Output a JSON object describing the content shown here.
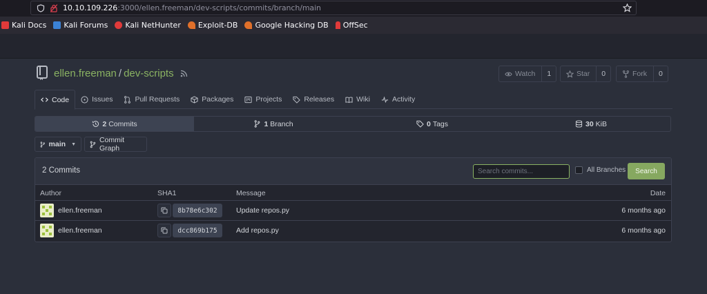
{
  "browser": {
    "url_host": "10.10.109.226",
    "url_rest": ":3000/ellen.freeman/dev-scripts/commits/branch/main",
    "bookmarks": [
      {
        "label": "Kali Docs",
        "color": "#e03a3a"
      },
      {
        "label": "Kali Forums",
        "color": "#3b82d6"
      },
      {
        "label": "Kali NetHunter",
        "color": "#e03a3a"
      },
      {
        "label": "Exploit-DB",
        "color": "#e0702a"
      },
      {
        "label": "Google Hacking DB",
        "color": "#e0702a"
      },
      {
        "label": "OffSec",
        "color": "#e03a3a"
      }
    ]
  },
  "repo": {
    "owner": "ellen.freeman",
    "separator": "/",
    "name": "dev-scripts",
    "watch_label": "Watch",
    "watch_count": "1",
    "star_label": "Star",
    "star_count": "0",
    "fork_label": "Fork",
    "fork_count": "0"
  },
  "tabs": [
    "Code",
    "Issues",
    "Pull Requests",
    "Packages",
    "Projects",
    "Releases",
    "Wiki",
    "Activity"
  ],
  "stats": {
    "commits_num": "2",
    "commits_label": "Commits",
    "branches_num": "1",
    "branches_label": "Branch",
    "tags_num": "0",
    "tags_label": "Tags",
    "size_num": "30",
    "size_label": "KiB"
  },
  "branch": {
    "current": "main",
    "graph_label": "Commit Graph"
  },
  "commits_box": {
    "title": "2 Commits",
    "search_placeholder": "Search commits...",
    "all_branches_label": "All Branches",
    "search_button": "Search",
    "columns": {
      "author": "Author",
      "sha": "SHA1",
      "message": "Message",
      "date": "Date"
    },
    "rows": [
      {
        "author": "ellen.freeman",
        "sha": "8b78e6c302",
        "message": "Update repos.py",
        "date": "6 months ago"
      },
      {
        "author": "ellen.freeman",
        "sha": "dcc869b175",
        "message": "Add repos.py",
        "date": "6 months ago"
      }
    ]
  },
  "colors": {
    "accent": "#8ab262",
    "button_green": "#86a860"
  }
}
